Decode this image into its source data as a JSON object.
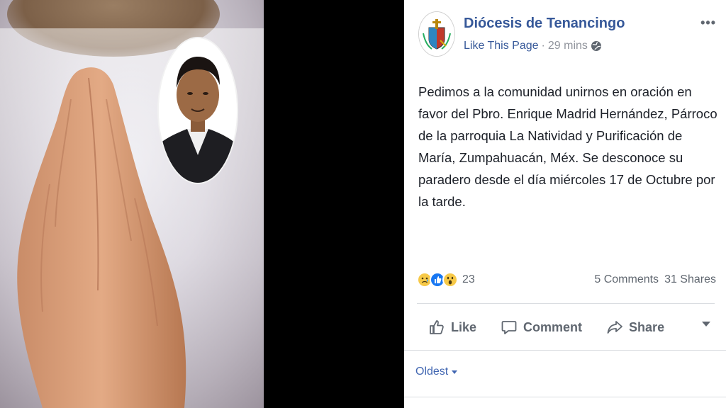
{
  "post": {
    "page_name": "Diócesis de Tenancingo",
    "like_page": "Like This Page",
    "separator": "·",
    "time": "29 mins",
    "audience_icon": "globe-icon",
    "more": "•••",
    "text": "Pedimos a la comunidad unirnos en oración en favor del Pbro. Enrique Madrid Hernández, Párroco de la parroquia La Natividad y Purificación de María, Zumpahuacán, Méx. Se desconoce su paradero desde el día miércoles 17 de Octubre por la tarde.",
    "reactions": {
      "types": [
        "sad",
        "like",
        "wow"
      ],
      "count": "23"
    },
    "comments": "5 Comments",
    "shares": "31 Shares",
    "actions": {
      "like": "Like",
      "comment": "Comment",
      "share": "Share"
    },
    "sort": "Oldest"
  },
  "colors": {
    "link": "#365899",
    "muted": "#90949c",
    "text": "#1d2129",
    "divider": "#dadde1"
  }
}
